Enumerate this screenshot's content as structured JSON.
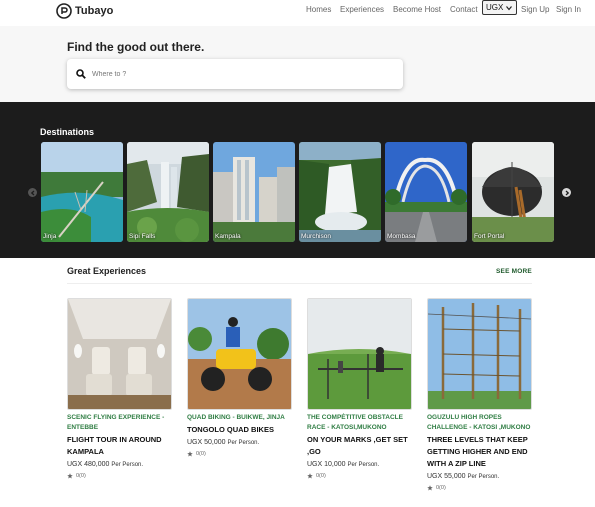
{
  "nav": {
    "brand": "Tubayo",
    "links": [
      "Homes",
      "Experiences",
      "Become Host",
      "Contact"
    ],
    "currency": "UGX",
    "sign_up": "Sign Up",
    "sign_in": "Sign In"
  },
  "hero": {
    "title": "Find the good out there.",
    "search_placeholder": "Where to ?"
  },
  "destinations": {
    "heading": "Destinations",
    "items": [
      "Jinja",
      "Sipi Falls",
      "Kampala",
      "Murchison",
      "Mombasa",
      "Fort Portal"
    ]
  },
  "experiences": {
    "heading": "Great Experiences",
    "see_more": "SEE MORE",
    "items": [
      {
        "category": "SCENIC FLYING EXPERIENCE - ENTEBBE",
        "title": "FLIGHT TOUR IN AROUND KAMPALA",
        "price": "UGX 480,000",
        "per": "Per Person.",
        "rating": "0(0)"
      },
      {
        "category": "QUAD BIKING - BUIKWE, JINJA",
        "title": "TONGOLO QUAD BIKES",
        "price": "UGX 50,000",
        "per": "Per Person.",
        "rating": "0(0)"
      },
      {
        "category": "THE COMPĖTITIVE OBSTACLE RACE - KATOSI,MUKONO",
        "title": "ON YOUR MARKS ,GET SET ,GO",
        "price": "UGX 10,000",
        "per": "Per Person.",
        "rating": "0(0)"
      },
      {
        "category": "OGUZULU HIGH ROPES CHALLENGE - KATOSI ,MUKONO",
        "title": "THREE LEVELS THAT KEEP GETTING HIGHER AND END WITH A ZIP LINE",
        "price": "UGX 55,000",
        "per": "Per Person.",
        "rating": "0(0)"
      }
    ]
  },
  "colors": {
    "accent_green": "#2f7d43",
    "dark_band": "#1c1c1c"
  },
  "icons": [
    "logo-icon",
    "search-icon",
    "chevron-down-icon",
    "chevron-left-icon",
    "chevron-right-icon",
    "star-icon"
  ]
}
